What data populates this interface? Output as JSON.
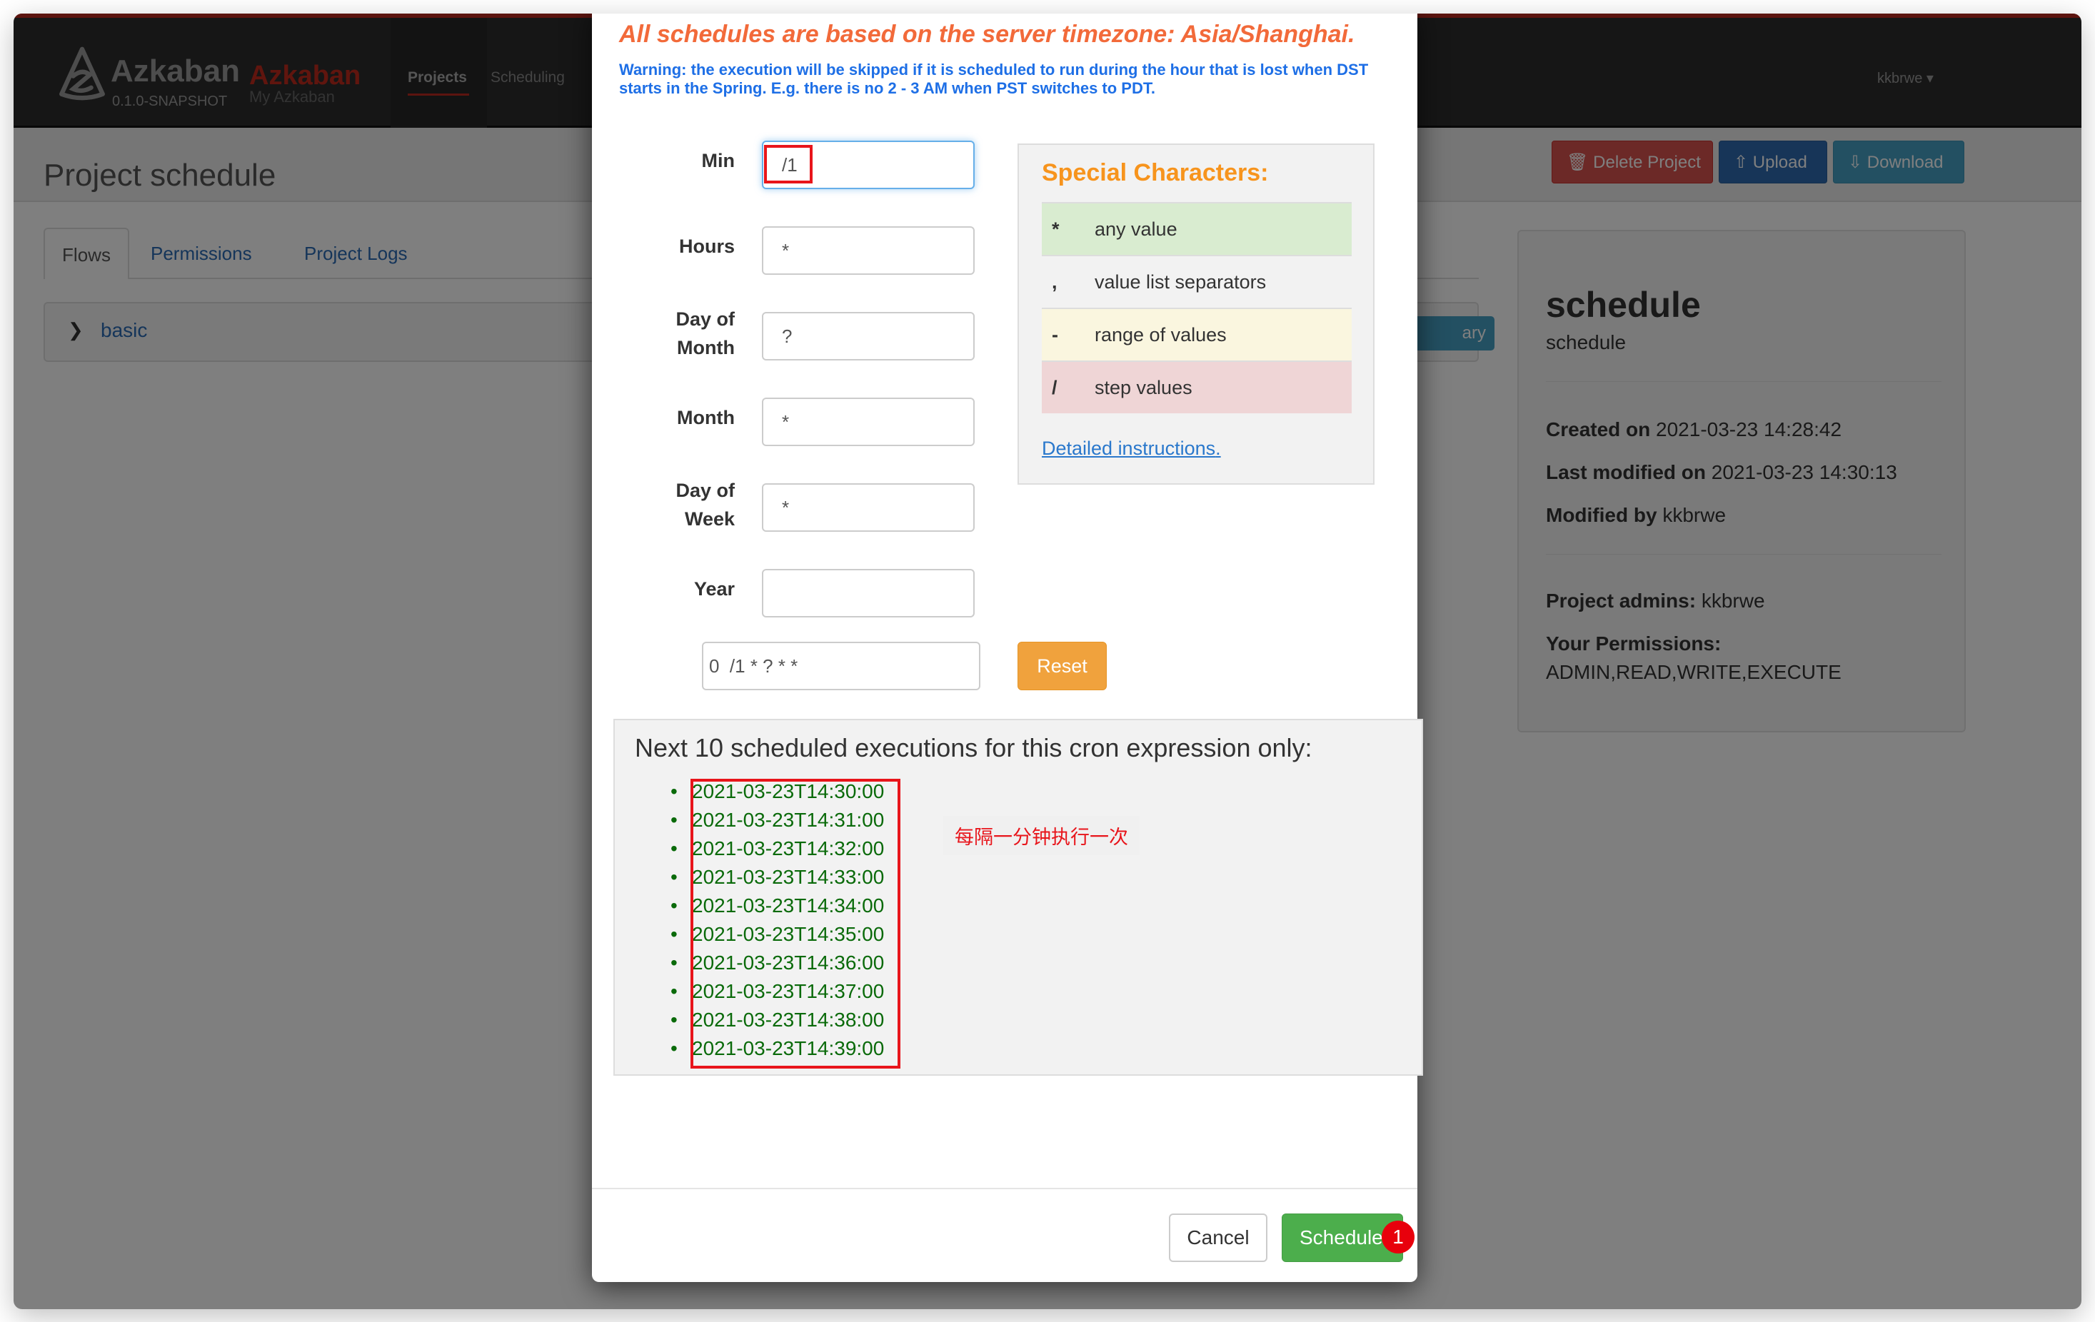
{
  "header": {
    "brand": "Azkaban",
    "brand_secondary": "Azkaban",
    "version": "0.1.0-SNAPSHOT",
    "subtitle": "My Azkaban",
    "nav": [
      {
        "label": "Projects",
        "active": true
      },
      {
        "label": "Scheduling",
        "active": false
      }
    ],
    "user": "kkbrwe",
    "user_caret": "▾"
  },
  "page": {
    "title": "Project schedule",
    "actions": {
      "delete": "Delete Project",
      "upload": "Upload",
      "download": "Download"
    },
    "tabs": [
      "Flows",
      "Permissions",
      "Project Logs"
    ],
    "flow": {
      "name": "basic",
      "summary_label": "ary"
    }
  },
  "project_info": {
    "name": "schedule",
    "description": "schedule",
    "created_label": "Created on",
    "created_value": "2021-03-23 14:28:42",
    "modified_label": "Last modified on",
    "modified_value": "2021-03-23 14:30:13",
    "modified_by_label": "Modified by",
    "modified_by_value": "kkbrwe",
    "admins_label": "Project admins:",
    "admins_value": "kkbrwe",
    "permissions_label": "Your Permissions:",
    "permissions_value": "ADMIN,READ,WRITE,EXECUTE"
  },
  "modal": {
    "timezone_note": "All schedules are based on the server timezone: Asia/Shanghai.",
    "dst_warning": "Warning: the execution will be skipped if it is scheduled to run during the hour that is lost when DST starts in the Spring. E.g. there is no 2 - 3 AM when PST switches to PDT.",
    "fields": [
      {
        "label": "Min",
        "value": "/1"
      },
      {
        "label": "Hours",
        "value": "*"
      },
      {
        "label": "Day of Month",
        "value": "?"
      },
      {
        "label": "Month",
        "value": "*"
      },
      {
        "label": "Day of Week",
        "value": "*"
      },
      {
        "label": "Year",
        "value": ""
      }
    ],
    "cron_expression": "0  /1 * ? * *",
    "reset_label": "Reset",
    "special_chars": {
      "title": "Special Characters:",
      "rows": [
        {
          "symbol": "*",
          "description": "any value",
          "color": "#d9ecd0"
        },
        {
          "symbol": ",",
          "description": "value list separators",
          "color": "#f2f2f2"
        },
        {
          "symbol": "-",
          "description": "range of values",
          "color": "#faf6df"
        },
        {
          "symbol": "/",
          "description": "step values",
          "color": "#efd5d6"
        }
      ],
      "link_text": "Detailed instructions",
      "link_suffix": "."
    },
    "executions_title": "Next 10 scheduled executions for this cron expression only:",
    "executions": [
      "2021-03-23T14:30:00",
      "2021-03-23T14:31:00",
      "2021-03-23T14:32:00",
      "2021-03-23T14:33:00",
      "2021-03-23T14:34:00",
      "2021-03-23T14:35:00",
      "2021-03-23T14:36:00",
      "2021-03-23T14:37:00",
      "2021-03-23T14:38:00",
      "2021-03-23T14:39:00"
    ],
    "annotation_note": "每隔一分钟执行一次",
    "cancel_label": "Cancel",
    "schedule_label": "Schedule",
    "badge": "1"
  },
  "colors": {
    "accent_red": "#b9291f",
    "warning_orange": "#f26a3a",
    "info_blue": "#1e6fe6",
    "success_green": "#4cae4c",
    "reset_orange": "#f0a23d",
    "annotation_red": "#e8151b"
  }
}
